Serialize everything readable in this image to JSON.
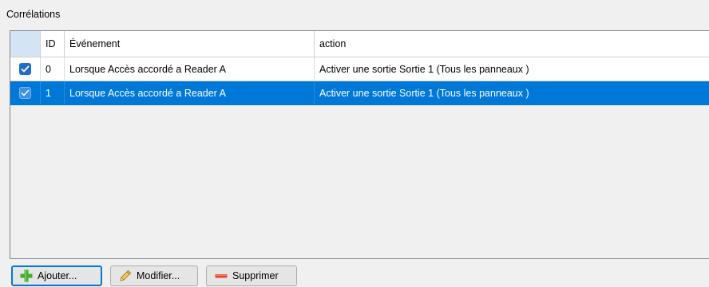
{
  "group": {
    "title": "Corrélations"
  },
  "grid": {
    "columns": {
      "id": "ID",
      "event": "Événement",
      "action": "action"
    },
    "rows": [
      {
        "checked": true,
        "selected": false,
        "id": "0",
        "event": "Lorsque Accès accordé a Reader A",
        "action": "Activer une sortie Sortie 1 (Tous les panneaux )"
      },
      {
        "checked": true,
        "selected": true,
        "id": "1",
        "event": "Lorsque Accès accordé a Reader A",
        "action": "Activer une sortie Sortie 1 (Tous les panneaux )"
      }
    ]
  },
  "buttons": {
    "add": {
      "label": "Ajouter...",
      "icon": "plus-icon"
    },
    "edit": {
      "label": "Modifier...",
      "icon": "pencil-icon"
    },
    "delete": {
      "label": "Supprimer",
      "icon": "minus-icon"
    }
  },
  "colors": {
    "selection": "#0078d7",
    "checkbox": "#1f6fc6",
    "add_icon": "#3dae2b",
    "delete_icon": "#e0442a",
    "edit_icon": "#e8a33a"
  }
}
